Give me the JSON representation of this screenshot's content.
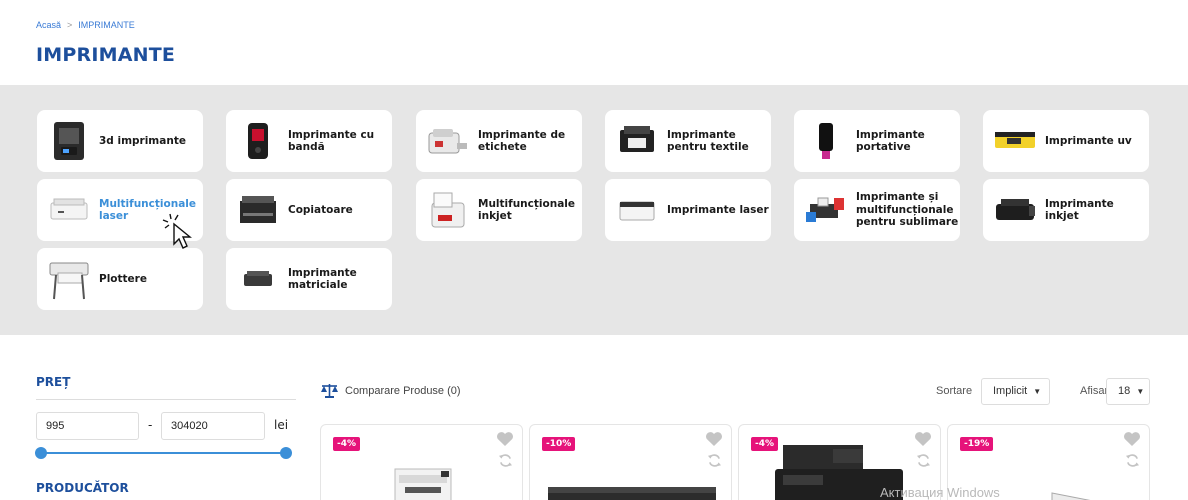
{
  "breadcrumb": {
    "home": "Acasă",
    "separator": ">",
    "current": "IMPRIMANTE"
  },
  "page_title": "IMPRIMANTE",
  "categories": [
    {
      "label": "3d imprimante",
      "icon": "3d-printer-icon"
    },
    {
      "label": "Imprimante cu bandă",
      "icon": "label-tape-printer-icon"
    },
    {
      "label": "Imprimante de etichete",
      "icon": "label-printer-icon"
    },
    {
      "label": "Imprimante pentru textile",
      "icon": "textile-printer-icon"
    },
    {
      "label": "Imprimante portative",
      "icon": "portable-printer-icon"
    },
    {
      "label": "Imprimante uv",
      "icon": "uv-printer-icon"
    },
    {
      "label": "Multifuncționale laser",
      "icon": "laser-mfp-icon"
    },
    {
      "label": "Copiatoare",
      "icon": "copier-icon"
    },
    {
      "label": "Multifuncționale inkjet",
      "icon": "inkjet-mfp-icon"
    },
    {
      "label": "Imprimante laser",
      "icon": "laser-printer-icon"
    },
    {
      "label": "Imprimante și multifuncționale pentru sublimare",
      "icon": "sublimation-printer-icon"
    },
    {
      "label": "Imprimante inkjet",
      "icon": "inkjet-printer-icon"
    },
    {
      "label": "Plottere",
      "icon": "plotter-icon"
    },
    {
      "label": "Imprimante matriciale",
      "icon": "dot-matrix-printer-icon"
    }
  ],
  "filters": {
    "price_title": "PREȚ",
    "price_min": "995",
    "price_max": "304020",
    "dash": "-",
    "currency": "lei",
    "producer_title": "PRODUCĂTOR"
  },
  "toolbar": {
    "compare_label": "Comparare Produse (0)",
    "sort_label": "Sortare",
    "sort_value": "Implicit",
    "show_label": "Afisare",
    "show_value": "18"
  },
  "products": [
    {
      "discount": "-4%"
    },
    {
      "discount": "-10%"
    },
    {
      "discount": "-4%"
    },
    {
      "discount": "-19%"
    }
  ],
  "watermark": "Активация Windows",
  "colors": {
    "accent": "#1d4f9c",
    "link": "#3b8fd8",
    "badge": "#e6137a",
    "band": "#e6e6e6"
  }
}
